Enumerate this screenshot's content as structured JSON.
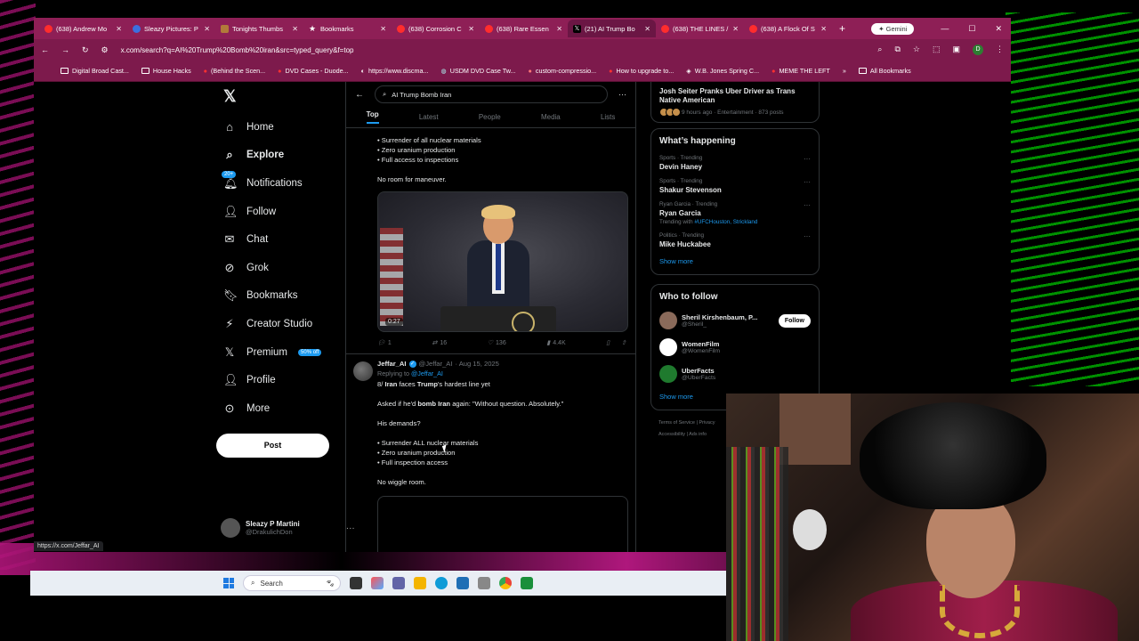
{
  "browser": {
    "tabs": [
      {
        "label": "(638) Andrew Mo",
        "icon": "youtube-icon"
      },
      {
        "label": "Sleazy Pictures: P",
        "icon": "site-icon"
      },
      {
        "label": "Tonights Thumbs",
        "icon": "image-icon"
      },
      {
        "label": "Bookmarks",
        "icon": "star-icon"
      },
      {
        "label": "(638) Corrosion C",
        "icon": "youtube-icon"
      },
      {
        "label": "(638) Rare Essen",
        "icon": "youtube-icon"
      },
      {
        "label": "(21) AI Trump Bo",
        "icon": "x-icon",
        "active": true
      },
      {
        "label": "(638) THE LINES /",
        "icon": "youtube-icon"
      },
      {
        "label": "(638) A Flock Of S",
        "icon": "youtube-icon"
      }
    ],
    "gemini_label": "Gemini",
    "url": "x.com/search?q=AI%20Trump%20Bomb%20iran&src=typed_query&f=top",
    "profile_initial": "D",
    "bookmarks": [
      "Digital Broad Cast...",
      "House Hacks",
      "(Behind the Scen...",
      "DVD Cases - Duode...",
      "https://www.discma...",
      "USDM DVD Case Tw...",
      "custom-compressio...",
      "How to upgrade to...",
      "W.B. Jones Spring C...",
      "MEME THE LEFT"
    ],
    "all_bookmarks": "All Bookmarks",
    "status_url": "https://x.com/Jeffar_AI"
  },
  "nav": {
    "items": [
      {
        "label": "Home",
        "icon": "home-icon"
      },
      {
        "label": "Explore",
        "icon": "search-icon",
        "bold": true
      },
      {
        "label": "Notifications",
        "icon": "bell-icon",
        "badge": "20+"
      },
      {
        "label": "Follow",
        "icon": "person-plus-icon"
      },
      {
        "label": "Chat",
        "icon": "mail-icon"
      },
      {
        "label": "Grok",
        "icon": "grok-icon"
      },
      {
        "label": "Bookmarks",
        "icon": "bookmark-icon"
      },
      {
        "label": "Creator Studio",
        "icon": "lightning-icon"
      },
      {
        "label": "Premium",
        "icon": "x-icon",
        "badge": "50% off"
      },
      {
        "label": "Profile",
        "icon": "person-icon"
      },
      {
        "label": "More",
        "icon": "more-circle-icon"
      }
    ],
    "post_label": "Post",
    "user_name": "Sleazy P Martini",
    "user_handle": "@DrakulichDon"
  },
  "search": {
    "query": "AI Trump Bomb Iran",
    "tabs": [
      "Top",
      "Latest",
      "People",
      "Media",
      "Lists"
    ],
    "active_tab": "Top"
  },
  "tweet1": {
    "lines": [
      "• Surrender of all nuclear materials",
      "• Zero uranium production",
      "• Full access to inspections"
    ],
    "closing": "No room for maneuver.",
    "video_duration": "0:27",
    "replies": "1",
    "reposts": "16",
    "likes": "136",
    "views": "4.4K"
  },
  "tweet2": {
    "name": "Jeffar_AI",
    "handle": "@Jeffar_AI",
    "date": "· Aug 15, 2025",
    "replying_prefix": "Replying to",
    "replying_to": "@Jeffar_AI",
    "line1_a": "8/ ",
    "line1_b": "Iran",
    "line1_c": " faces ",
    "line1_d": "Trump",
    "line1_e": "'s hardest line yet",
    "line2_a": "Asked if he'd ",
    "line2_b": "bomb Iran",
    "line2_c": " again: \"Without question. Absolutely.\"",
    "line3": "His demands?",
    "bullets": [
      "• Surrender ALL nuclear materials",
      "• Zero uranium production",
      "• Full inspection access"
    ],
    "closing": "No wiggle room."
  },
  "right": {
    "top_trend_title": "Josh Seiter Pranks Uber Driver as Trans Native American",
    "top_trend_meta": "9 hours ago · Entertainment · 873 posts",
    "happening_title": "What’s happening",
    "trends": [
      {
        "category": "Sports · Trending",
        "title": "Devin Haney"
      },
      {
        "category": "Sports · Trending",
        "title": "Shakur Stevenson"
      },
      {
        "category": "Ryan Garcia · Trending",
        "title": "Ryan Garcia",
        "with_prefix": "Trending with",
        "with": "#UFCHouston, Strickland"
      },
      {
        "category": "Politics · Trending",
        "title": "Mike Huckabee"
      }
    ],
    "show_more": "Show more",
    "who_title": "Who to follow",
    "who": [
      {
        "name": "Sheril Kirshenbaum, P...",
        "handle": "@Sheril_",
        "follow": "Follow"
      },
      {
        "name": "WomenFilm",
        "handle": "@WomenFilm"
      },
      {
        "name": "UberFacts",
        "handle": "@UberFacts"
      }
    ],
    "footer1": "Terms of Service  |  Privacy",
    "footer2": "Accessibility  |  Ads info"
  },
  "taskbar": {
    "search_label": "Search"
  },
  "colors": {
    "tab_bar": "#8e1f56",
    "x_blue": "#1d9bf0",
    "background": "#000000"
  }
}
